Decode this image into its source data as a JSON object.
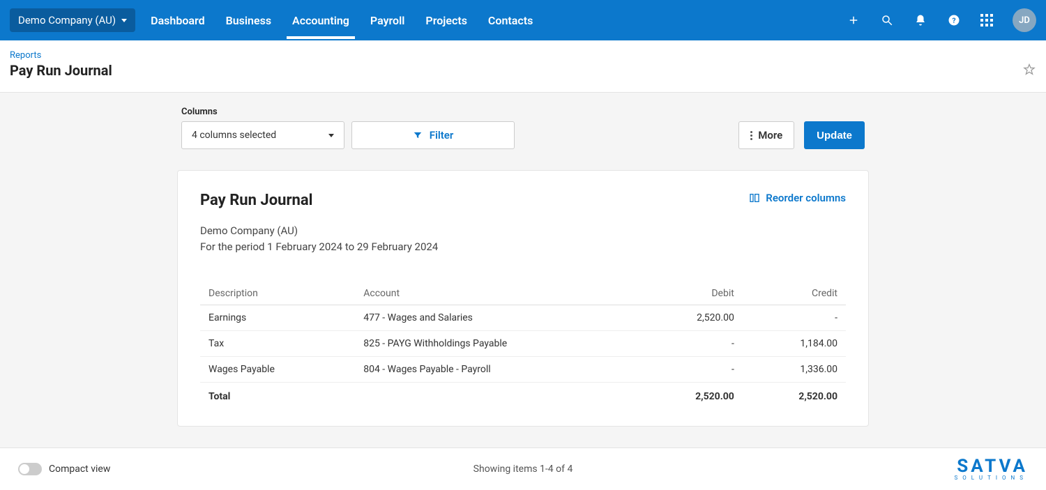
{
  "nav": {
    "org": "Demo Company (AU)",
    "links": [
      "Dashboard",
      "Business",
      "Accounting",
      "Payroll",
      "Projects",
      "Contacts"
    ],
    "active_index": 2,
    "avatar": "JD"
  },
  "page": {
    "breadcrumb": "Reports",
    "title": "Pay Run Journal"
  },
  "controls": {
    "columns_label": "Columns",
    "columns_selected": "4 columns selected",
    "filter_label": "Filter",
    "more_label": "More",
    "update_label": "Update"
  },
  "report": {
    "title": "Pay Run Journal",
    "reorder_label": "Reorder columns",
    "company": "Demo Company (AU)",
    "period": "For the period 1 February 2024 to 29 February 2024",
    "columns": [
      "Description",
      "Account",
      "Debit",
      "Credit"
    ],
    "rows": [
      {
        "description": "Earnings",
        "account": "477 - Wages and Salaries",
        "debit": "2,520.00",
        "credit": "-"
      },
      {
        "description": "Tax",
        "account": "825 - PAYG Withholdings Payable",
        "debit": "-",
        "credit": "1,184.00"
      },
      {
        "description": "Wages Payable",
        "account": "804 - Wages Payable - Payroll",
        "debit": "-",
        "credit": "1,336.00"
      }
    ],
    "total": {
      "label": "Total",
      "debit": "2,520.00",
      "credit": "2,520.00"
    }
  },
  "footer": {
    "compact_label": "Compact view",
    "showing": "Showing items 1-4 of 4",
    "brand_main": "SATVA",
    "brand_sub": "SOLUTIONS"
  }
}
